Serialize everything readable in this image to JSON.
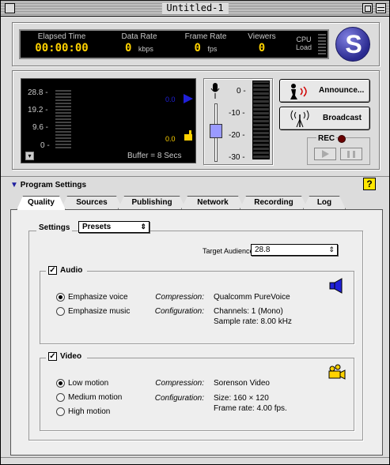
{
  "window": {
    "title": "Untitled-1"
  },
  "status": {
    "elapsed_label": "Elapsed Time",
    "elapsed_value": "00:00:00",
    "datarate_label": "Data Rate",
    "datarate_value": "0",
    "datarate_unit": "kbps",
    "framerate_label": "Frame Rate",
    "framerate_value": "0",
    "framerate_unit": "fps",
    "viewers_label": "Viewers",
    "viewers_value": "0",
    "cpu_label": "CPU",
    "load_label": "Load"
  },
  "logo": {
    "letter": "S"
  },
  "bandwidth_meter": {
    "ticks": [
      "28.8 -",
      "19.2 -",
      "9.6 -",
      "0 -"
    ],
    "blue_value": "0.0",
    "yellow_value": "0.0",
    "buffer_text": "Buffer = 8 Secs"
  },
  "audio_level": {
    "ticks": [
      "0 -",
      "-10 -",
      "-20 -",
      "-30 -"
    ]
  },
  "buttons": {
    "announce": "Announce...",
    "broadcast": "Broadcast",
    "rec_label": "REC"
  },
  "program_settings": {
    "header": "Program Settings",
    "help": "?",
    "tabs": [
      "Quality",
      "Sources",
      "Publishing",
      "Network",
      "Recording",
      "Log"
    ],
    "settings_label": "Settings",
    "settings_value": "Presets",
    "target_audience_label": "Target Audience",
    "target_audience_value": "28.8"
  },
  "audio": {
    "label": "Audio",
    "options": [
      "Emphasize voice",
      "Emphasize music"
    ],
    "compression_label": "Compression:",
    "compression_value": "Qualcomm PureVoice",
    "configuration_label": "Configuration:",
    "channels": "Channels: 1 (Mono)",
    "sample_rate": "Sample rate: 8.00 kHz"
  },
  "video": {
    "label": "Video",
    "options": [
      "Low motion",
      "Medium motion",
      "High motion"
    ],
    "compression_label": "Compression:",
    "compression_value": "Sorenson Video",
    "configuration_label": "Configuration:",
    "size": "Size: 160 × 120",
    "frame_rate": "Frame rate: 4.00 fps."
  },
  "colors": {
    "blue_accent": "#2020d8",
    "yellow_accent": "#ffd200"
  }
}
